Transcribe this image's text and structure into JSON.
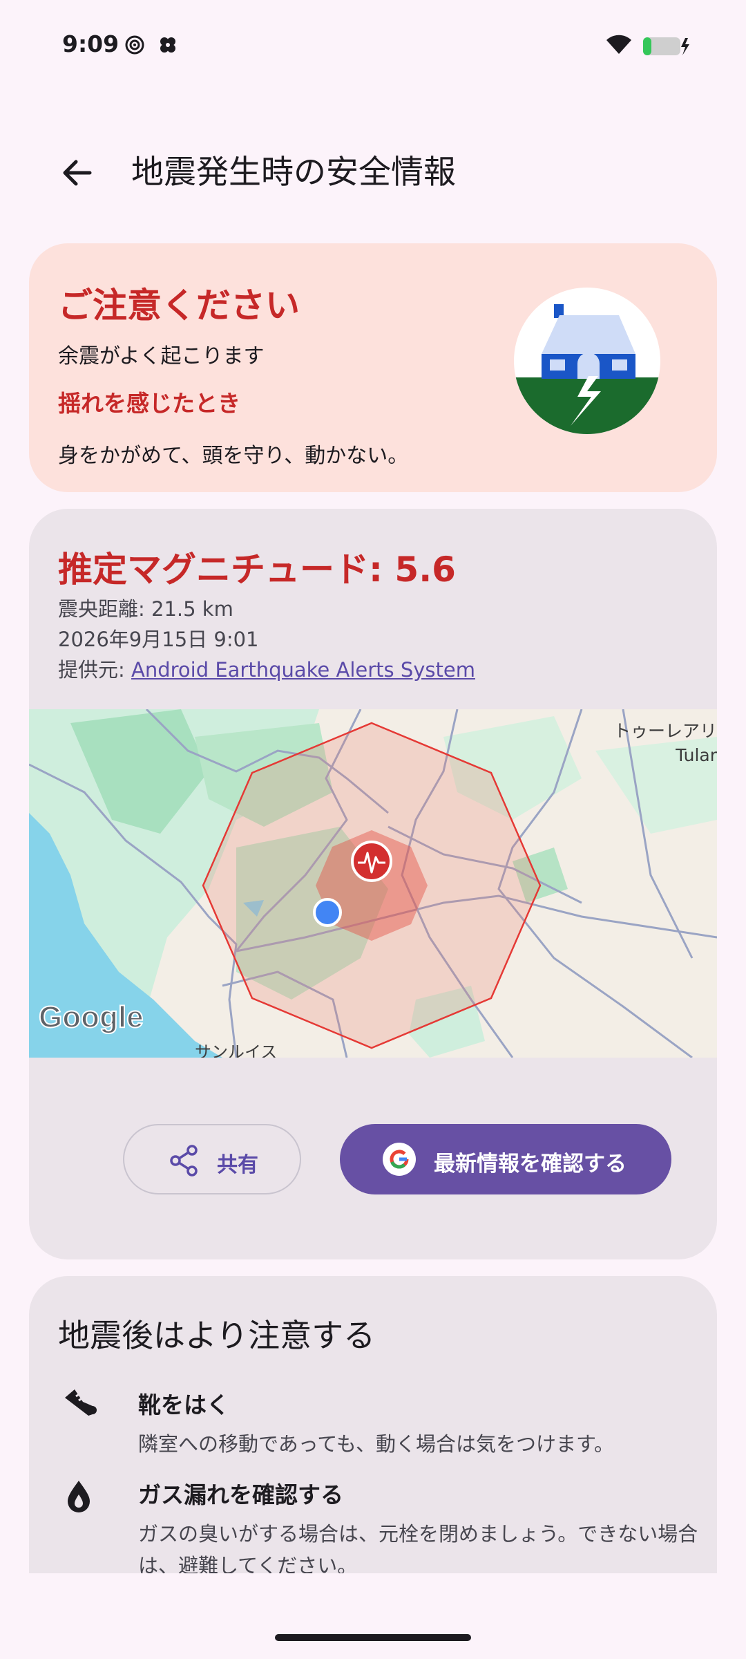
{
  "status_bar": {
    "time": "9:09"
  },
  "header": {
    "title": "地震発生時の安全情報"
  },
  "warning_card": {
    "heading": "ご注意ください",
    "subtitle": "余震がよく起こります",
    "subheading": "揺れを感じたとき",
    "instruction": "身をかがめて、頭を守り、動かない。"
  },
  "quake_card": {
    "magnitude": "推定マグニチュード: 5.6",
    "distance": "震央距離: 21.5 km",
    "datetime": "2026年9月15日 9:01",
    "provider_prefix": "提供元: ",
    "provider_link": "Android Earthquake Alerts System",
    "map": {
      "city_jp": "トゥーレアリ",
      "city_en": "Tular",
      "bottom_label": "サンルイス",
      "logo": "Google"
    },
    "share_label": "共有",
    "check_label": "最新情報を確認する"
  },
  "after_card": {
    "heading": "地震後はより注意する",
    "items": [
      {
        "icon": "shoe-icon",
        "title": "靴をはく",
        "desc": "隣室への移動であっても、動く場合は気をつけます。"
      },
      {
        "icon": "gas-drop-icon",
        "title": "ガス漏れを確認する",
        "desc": "ガスの臭いがする場合は、元栓を閉めましょう。できない場合は、避難してください。"
      }
    ]
  },
  "colors": {
    "accent": "#6750a4",
    "warning_red": "#c62828",
    "warning_bg": "#fde1dc",
    "card_bg": "#ebe4ea",
    "page_bg": "#fcf3fa"
  }
}
